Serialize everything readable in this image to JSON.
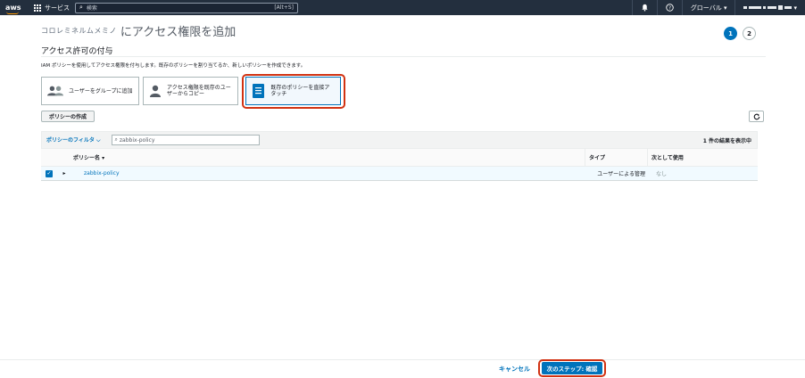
{
  "topbar": {
    "logo": "aws",
    "services_label": "サービス",
    "search_placeholder": "検索",
    "search_shortcut": "[Alt+S]",
    "region_label": "グローバル ▾"
  },
  "header": {
    "title_prefix": "コロレミネルムメミノ",
    "title": "にアクセス権限を追加",
    "steps": [
      "1",
      "2"
    ],
    "subtitle": "アクセス許可の付与",
    "description": "IAM ポリシーを使用してアクセス権限を付与します。既存のポリシーを割り当てるか、新しいポリシーを作成できます。"
  },
  "options": [
    {
      "label": "ユーザーをグループに追加",
      "icon": "group-icon"
    },
    {
      "label": "アクセス権限を既存のユーザーからコピー",
      "icon": "user-icon"
    },
    {
      "label": "既存のポリシーを直接アタッチ",
      "icon": "document-icon"
    }
  ],
  "toolbar": {
    "create_policy_label": "ポリシーの作成"
  },
  "table": {
    "filter_label": "ポリシーのフィルタ ⌵",
    "filter_value": "zabbix-policy",
    "result_count": "1 件の結果を表示中",
    "columns": [
      "ポリシー名 ▾",
      "タイプ",
      "次として使用"
    ],
    "rows": [
      {
        "name": "zabbix-policy",
        "type": "ユーザーによる管理",
        "used_as": "なし",
        "checked": true
      }
    ]
  },
  "footer": {
    "cancel_label": "キャンセル",
    "next_label": "次のステップ: 確認"
  },
  "colors": {
    "accent": "#0073bb",
    "highlight": "#d13212",
    "topbar": "#232f3e"
  }
}
